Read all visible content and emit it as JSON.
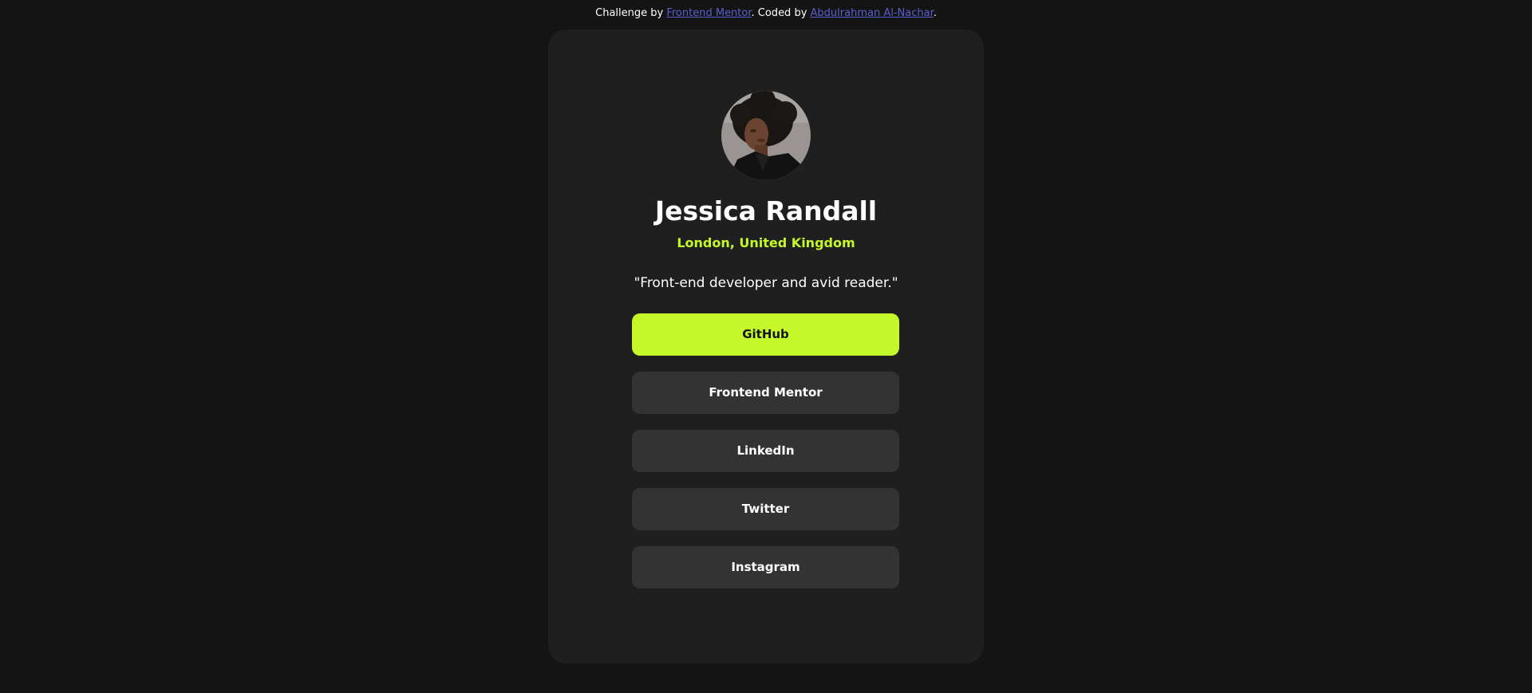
{
  "attribution": {
    "prefix": "Challenge by ",
    "challenge_link": "Frontend Mentor",
    "middle": ". Coded by ",
    "author_link": "Abdulrahman Al-Nachar",
    "suffix": "."
  },
  "profile": {
    "name": "Jessica Randall",
    "location": "London, United Kingdom",
    "bio": "\"Front-end developer and avid reader.\""
  },
  "links": [
    {
      "label": "GitHub"
    },
    {
      "label": "Frontend Mentor"
    },
    {
      "label": "LinkedIn"
    },
    {
      "label": "Twitter"
    },
    {
      "label": "Instagram"
    }
  ],
  "colors": {
    "background": "#141414",
    "card": "#1f1f1f",
    "button": "#333333",
    "accent": "#c4f82a",
    "link": "#5a5fd0"
  }
}
